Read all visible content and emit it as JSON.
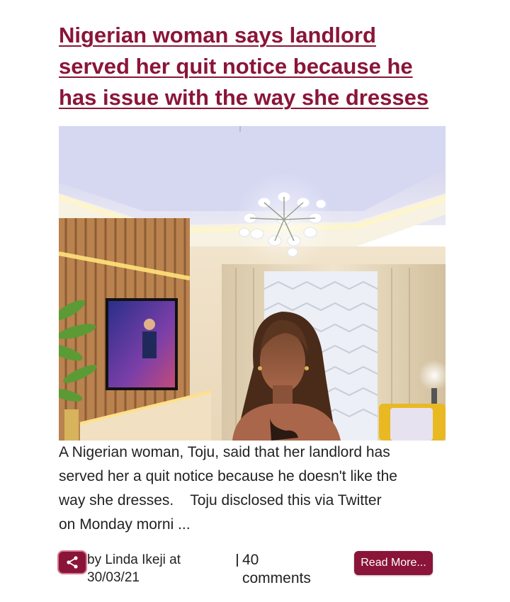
{
  "post": {
    "title_lines": [
      "Nigerian woman says landlord",
      "served her quit notice because he",
      "has issue with the way she dresses"
    ],
    "excerpt_lines": [
      "A Nigerian woman, Toju, said that her landlord has",
      "served her a quit notice because he doesn't like the",
      "way she dresses.    Toju disclosed this via Twitter",
      "on Monday morni ..."
    ],
    "byline_lines": [
      "by Linda Ikeji at",
      "30/03/21"
    ],
    "comments_lines": [
      "40",
      "comments"
    ],
    "read_more_label": "Read More...",
    "share_icon": "share-icon"
  },
  "colors": {
    "accent": "#8a1538",
    "text": "#222222",
    "background": "#ffffff"
  }
}
